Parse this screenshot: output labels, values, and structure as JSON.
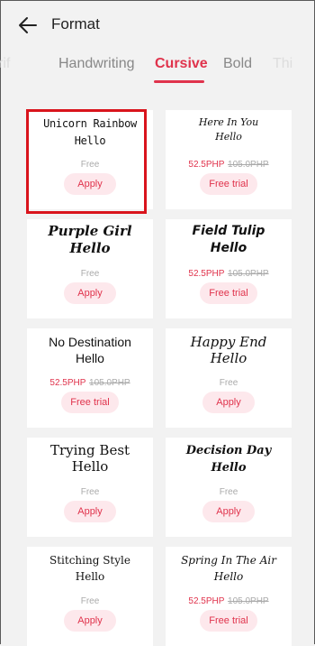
{
  "header": {
    "title": "Format"
  },
  "tabs": [
    {
      "label": "rif"
    },
    {
      "label": "Handwriting"
    },
    {
      "label": "Cursive"
    },
    {
      "label": "Bold"
    },
    {
      "label": "Thi"
    }
  ],
  "cards": [
    {
      "line1": "Unicorn Rainbow",
      "line2": "Hello",
      "price_free": "Free",
      "button": "Apply"
    },
    {
      "line1": "Here In You",
      "line2": "Hello",
      "price_now": "52.5PHP",
      "price_old": "105.0PHP",
      "button": "Free trial"
    },
    {
      "line1": "Purple Girl",
      "line2": "Hello",
      "price_free": "Free",
      "button": "Apply"
    },
    {
      "line1": "Field Tulip",
      "line2": "Hello",
      "price_now": "52.5PHP",
      "price_old": "105.0PHP",
      "button": "Free trial"
    },
    {
      "line1": "No Destination",
      "line2": "Hello",
      "price_now": "52.5PHP",
      "price_old": "105.0PHP",
      "button": "Free trial"
    },
    {
      "line1": "Happy End",
      "line2": "Hello",
      "price_free": "Free",
      "button": "Apply"
    },
    {
      "line1": "Trying Best",
      "line2": "Hello",
      "price_free": "Free",
      "button": "Apply"
    },
    {
      "line1": "Decision Day",
      "line2": "Hello",
      "price_free": "Free",
      "button": "Apply"
    },
    {
      "line1": "Stitching Style",
      "line2": "Hello",
      "price_free": "Free",
      "button": "Apply"
    },
    {
      "line1": "Spring In The Air",
      "line2": "Hello",
      "price_now": "52.5PHP",
      "price_old": "105.0PHP",
      "button": "Free trial"
    }
  ],
  "colors": {
    "accent": "#e0334c",
    "highlight_box": "#d9141c"
  }
}
